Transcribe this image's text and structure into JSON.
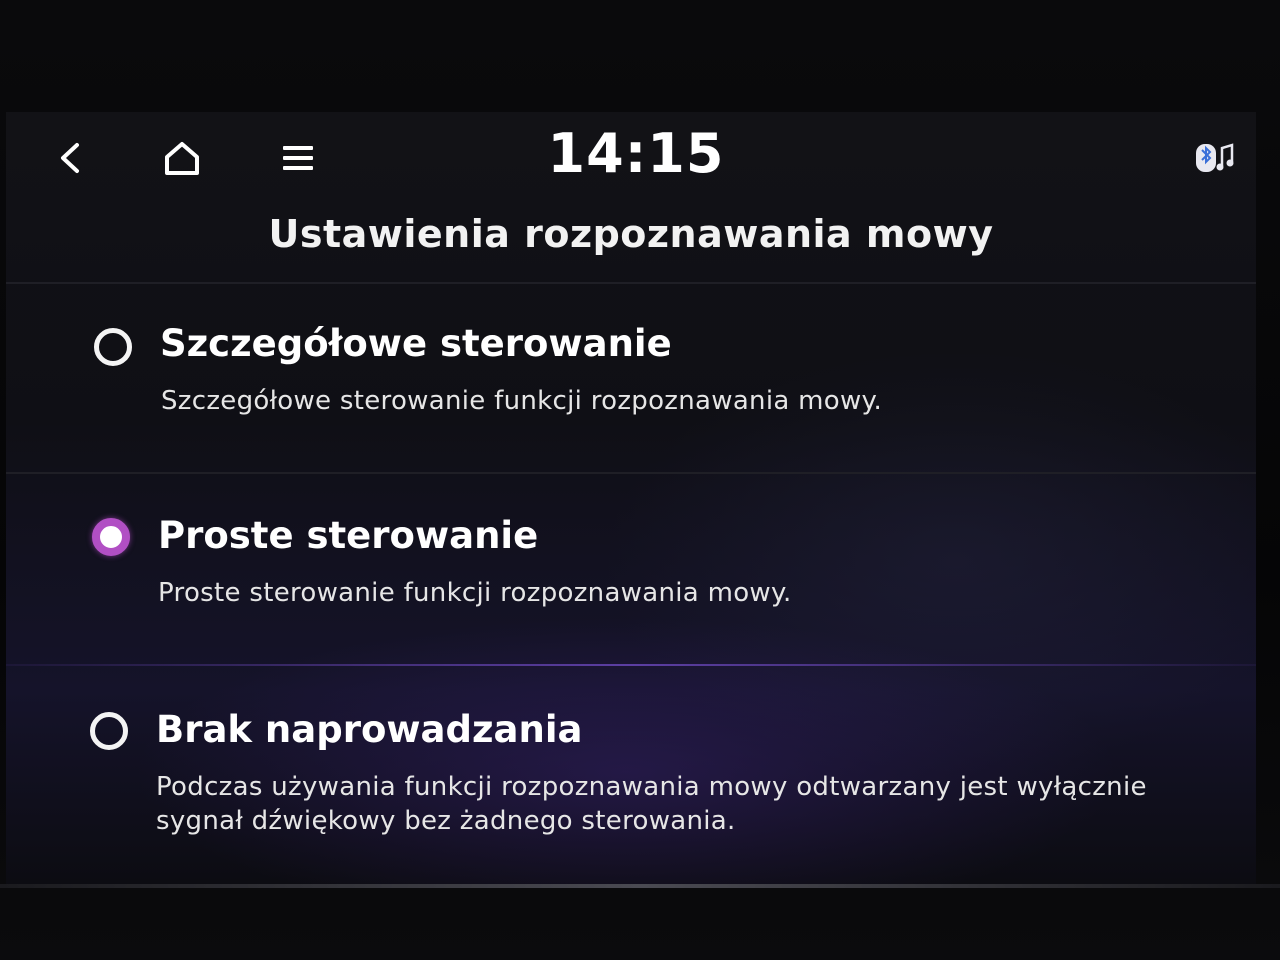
{
  "status_bar": {
    "time": "14:15",
    "back_icon": "back-chevron-icon",
    "home_icon": "home-icon",
    "menu_icon": "hamburger-menu-icon",
    "status_icon": "bluetooth-audio-icon"
  },
  "page": {
    "title": "Ustawienia rozpoznawania mowy"
  },
  "options": [
    {
      "title": "Szczegółowe sterowanie",
      "description": "Szczegółowe sterowanie funkcji rozpoznawania mowy.",
      "selected": false
    },
    {
      "title": "Proste sterowanie",
      "description": "Proste sterowanie funkcji rozpoznawania mowy.",
      "selected": true
    },
    {
      "title": "Brak naprowadzania",
      "description": "Podczas używania funkcji rozpoznawania mowy odtwarzany jest wyłącznie sygnał dźwiękowy bez żadnego sterowania.",
      "selected": false
    }
  ],
  "colors": {
    "accent": "#b14fc4",
    "text": "#ffffff",
    "background": "#0f0f15"
  }
}
